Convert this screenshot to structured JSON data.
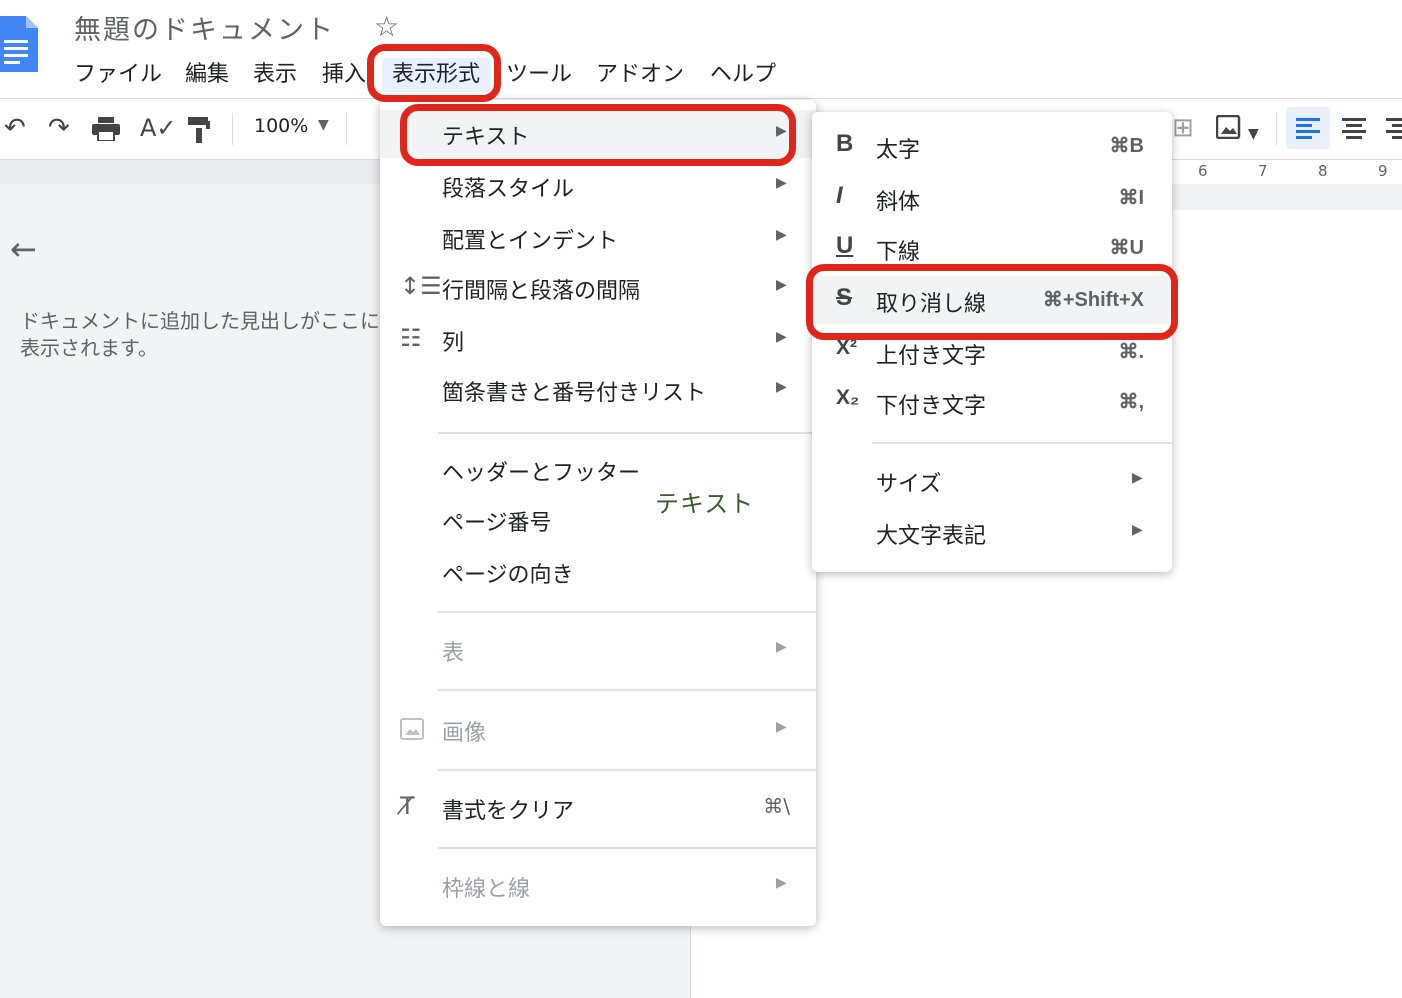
{
  "header": {
    "title": "無題のドキュメント",
    "star_icon": "star-icon",
    "menus": [
      "ファイル",
      "編集",
      "表示",
      "挿入",
      "表示形式",
      "ツール",
      "アドオン",
      "ヘルプ"
    ],
    "active_menu": "表示形式"
  },
  "toolbar": {
    "zoom": "100%",
    "icons": [
      "undo-icon",
      "redo-icon",
      "print-icon",
      "spellcheck-icon",
      "paint-format-icon",
      "add-comment-icon",
      "insert-image-icon",
      "align-left-icon",
      "align-center-icon",
      "align-right-icon"
    ],
    "ruler_ticks": [
      "6",
      "7",
      "8",
      "9"
    ]
  },
  "outline": {
    "hint": "ドキュメントに追加した見出しがここに表示されます。"
  },
  "format_menu": {
    "items": [
      {
        "label": "テキスト",
        "submenu": true
      },
      {
        "label": "段落スタイル",
        "submenu": true
      },
      {
        "label": "配置とインデント",
        "submenu": true
      },
      {
        "label": "行間隔と段落の間隔",
        "submenu": true
      },
      {
        "label": "列",
        "submenu": true
      },
      {
        "label": "箇条書きと番号付きリスト",
        "submenu": true
      },
      {
        "label": "ヘッダーとフッター"
      },
      {
        "label": "ページ番号"
      },
      {
        "label": "ページの向き"
      },
      {
        "label": "表",
        "submenu": true,
        "disabled": true
      },
      {
        "label": "画像",
        "submenu": true,
        "disabled": true
      },
      {
        "label": "書式をクリア",
        "shortcut": "⌘\\"
      },
      {
        "label": "枠線と線",
        "submenu": true,
        "disabled": true
      }
    ],
    "annotation": "テキスト"
  },
  "text_submenu": {
    "items": [
      {
        "icon": "bold-icon",
        "icon_glyph": "B",
        "label": "太字",
        "shortcut": "⌘B"
      },
      {
        "icon": "italic-icon",
        "icon_glyph": "I",
        "label": "斜体",
        "shortcut": "⌘I"
      },
      {
        "icon": "underline-icon",
        "icon_glyph": "U",
        "label": "下線",
        "shortcut": "⌘U"
      },
      {
        "icon": "strikethrough-icon",
        "icon_glyph": "S",
        "label": "取り消し線",
        "shortcut": "⌘+Shift+X"
      },
      {
        "icon": "superscript-icon",
        "icon_glyph": "X²",
        "label": "上付き文字",
        "shortcut": "⌘."
      },
      {
        "icon": "subscript-icon",
        "icon_glyph": "X₂",
        "label": "下付き文字",
        "shortcut": "⌘,"
      },
      {
        "label": "サイズ",
        "submenu": true
      },
      {
        "label": "大文字表記",
        "submenu": true
      }
    ]
  },
  "colors": {
    "highlight": "#e0261a",
    "accent": "#1a73e8",
    "annotation_text": "#3a5a2e"
  }
}
